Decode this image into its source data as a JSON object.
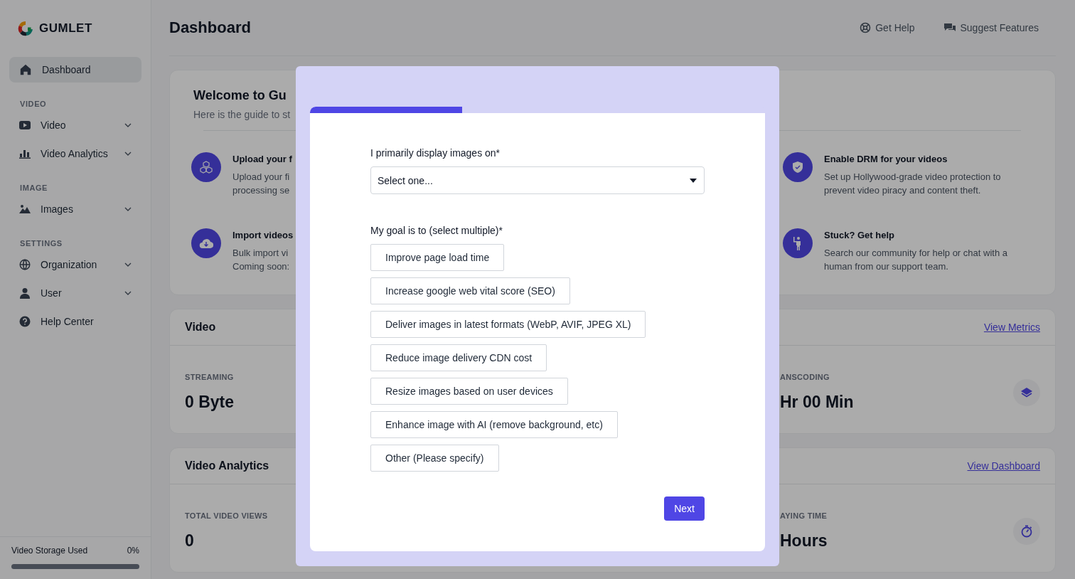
{
  "brand": {
    "name": "GUMLET"
  },
  "sidebar": {
    "sections": [
      {
        "items": [
          {
            "label": "Dashboard",
            "kind": "link",
            "selected": true
          }
        ]
      },
      {
        "label": "VIDEO",
        "items": [
          {
            "label": "Video",
            "kind": "group",
            "selected": false
          },
          {
            "label": "Video Analytics",
            "kind": "group",
            "selected": false
          }
        ]
      },
      {
        "label": "IMAGE",
        "items": [
          {
            "label": "Images",
            "kind": "group",
            "selected": false
          }
        ]
      },
      {
        "label": "SETTINGS",
        "items": [
          {
            "label": "Organization",
            "kind": "group",
            "selected": false
          },
          {
            "label": "User",
            "kind": "group",
            "selected": false
          },
          {
            "label": "Help Center",
            "kind": "link",
            "selected": false
          }
        ]
      }
    ],
    "storage": {
      "label": "Video Storage Used",
      "reading": "0%",
      "level": 0
    }
  },
  "header": {
    "title": "Dashboard",
    "links": [
      {
        "label": "Get Help"
      },
      {
        "label": "Suggest Features"
      }
    ]
  },
  "welcome": {
    "title": "Welcome to Gu",
    "subtitle": "Here is the guide to st",
    "left": [
      {
        "title": "Upload your f",
        "lines": [
          "Upload your fi",
          "processing se"
        ]
      },
      {
        "title": "Import videos",
        "lines": [
          "Bulk import vi",
          "Coming soon:"
        ]
      }
    ],
    "right": [
      {
        "title": "Enable DRM for your videos",
        "lines": [
          "Set up Hollywood-grade video protection to",
          "prevent video piracy and content theft."
        ]
      },
      {
        "title": "Stuck? Get help",
        "lines": [
          "Search our community for help or chat with a",
          "human from our support team."
        ]
      }
    ]
  },
  "sections": [
    {
      "title": "Video",
      "link": "View Metrics",
      "left": {
        "label": "STREAMING",
        "value": "0 Byte"
      },
      "right": {
        "label": "ANSCODING",
        "value": "Hr 00 Min"
      }
    },
    {
      "title": "Video Analytics",
      "link": "View Dashboard",
      "left": {
        "label": "TOTAL VIDEO VIEWS",
        "value": "0"
      },
      "right": {
        "label": "AYING TIME",
        "value": "Hours"
      }
    }
  ],
  "modal": {
    "progress": {
      "level": 0.335
    },
    "display_question": {
      "label": "I primarily display images on*",
      "placeholder": "Select one..."
    },
    "goal_question": {
      "label": "My goal is to (select multiple)*",
      "options": [
        {
          "label": "Improve page load time",
          "selected": false
        },
        {
          "label": "Increase google web vital score (SEO)",
          "selected": false
        },
        {
          "label": "Deliver images in latest formats (WebP, AVIF, JPEG XL)",
          "selected": false
        },
        {
          "label": "Reduce image delivery CDN cost",
          "selected": false
        },
        {
          "label": "Resize images based on user devices",
          "selected": false
        },
        {
          "label": "Enhance image with AI (remove background, etc)",
          "selected": false
        },
        {
          "label": "Other (Please specify)",
          "selected": false
        }
      ]
    },
    "next_button": "Next"
  }
}
